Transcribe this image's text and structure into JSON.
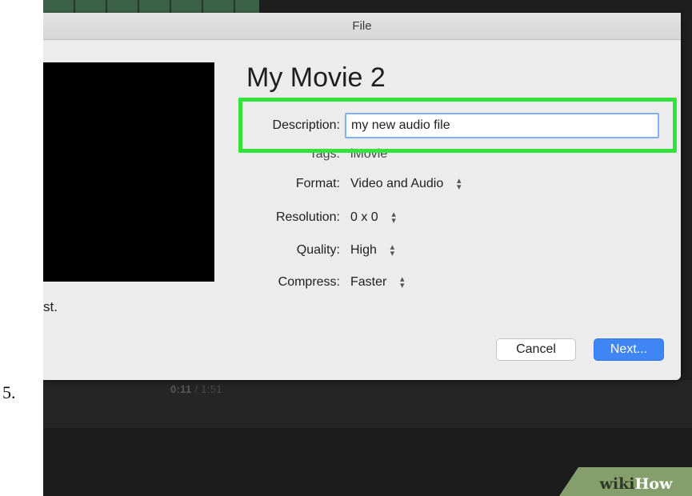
{
  "step": {
    "number": "5."
  },
  "dialog": {
    "title": "File",
    "movie_title": "My Movie 2",
    "fields": {
      "description": {
        "label": "Description:",
        "value": "my new audio file"
      },
      "tags": {
        "label": "Tags:",
        "value": "iMovie"
      },
      "format": {
        "label": "Format:",
        "value": "Video and Audio"
      },
      "resolution": {
        "label": "Resolution:",
        "value": "0 x 0"
      },
      "quality": {
        "label": "Quality:",
        "value": "High"
      },
      "compress": {
        "label": "Compress:",
        "value": "Faster"
      }
    },
    "left_text": "st.",
    "buttons": {
      "cancel": "Cancel",
      "next": "Next..."
    }
  },
  "player": {
    "current_time": "0:11",
    "separator": "/",
    "total_time": "1:51"
  },
  "watermark": {
    "part1": "wiki",
    "part2": "How"
  },
  "colors": {
    "highlight": "#33e33a",
    "next_button": "#3f85f4",
    "focus_ring": "#7fb1f2",
    "dialog_bg": "#ececec"
  }
}
